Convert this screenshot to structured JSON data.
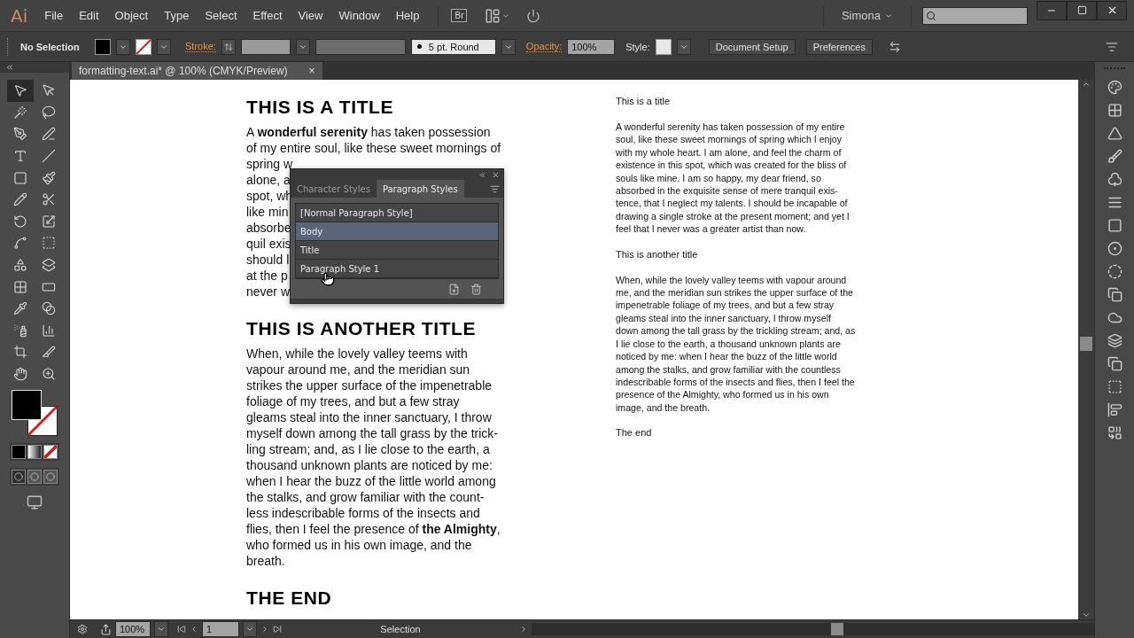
{
  "menu_bar": {
    "logo": "Ai",
    "menus": [
      "File",
      "Edit",
      "Object",
      "Type",
      "Select",
      "Effect",
      "View",
      "Window",
      "Help"
    ],
    "bridge_button": "Br",
    "user": "Simona"
  },
  "control_bar": {
    "selection": "No Selection",
    "stroke_label": "Stroke:",
    "brush": "5 pt. Round",
    "opacity_label": "Opacity:",
    "opacity": "100%",
    "style_label": "Style:",
    "buttons": [
      "Document Setup",
      "Preferences"
    ]
  },
  "document_tab": {
    "title": "formatting-text.ai* @ 100% (CMYK/Preview)",
    "close": "×"
  },
  "tools": [
    {
      "kind": "selection",
      "selected": true
    },
    {
      "kind": "direct-selection",
      "selected": false
    },
    {
      "kind": "magic-wand",
      "selected": false
    },
    {
      "kind": "lasso",
      "selected": false
    },
    {
      "kind": "pen",
      "selected": false
    },
    {
      "kind": "curvature",
      "selected": false
    },
    {
      "kind": "type",
      "selected": false
    },
    {
      "kind": "line",
      "selected": false
    },
    {
      "kind": "rectangle",
      "selected": false
    },
    {
      "kind": "paintbrush",
      "selected": false
    },
    {
      "kind": "pencil",
      "selected": false
    },
    {
      "kind": "scissors",
      "selected": false
    },
    {
      "kind": "rotate",
      "selected": false
    },
    {
      "kind": "scale",
      "selected": false
    },
    {
      "kind": "warp",
      "selected": false
    },
    {
      "kind": "free-transform",
      "selected": false
    },
    {
      "kind": "shape-builder",
      "selected": false
    },
    {
      "kind": "graph-stack",
      "selected": false
    },
    {
      "kind": "mesh",
      "selected": false
    },
    {
      "kind": "gradient",
      "selected": false
    },
    {
      "kind": "eyedropper",
      "selected": false
    },
    {
      "kind": "blend",
      "selected": false
    },
    {
      "kind": "symbol-sprayer",
      "selected": false
    },
    {
      "kind": "graph",
      "selected": false
    },
    {
      "kind": "artboard",
      "selected": false
    },
    {
      "kind": "slice",
      "selected": false
    },
    {
      "kind": "hand",
      "selected": false
    },
    {
      "kind": "zoom",
      "selected": false
    }
  ],
  "document": {
    "left": [
      {
        "kind": "heading",
        "text": "THIS IS A TITLE"
      },
      {
        "kind": "paragraph",
        "lines": [
          "A **wonderful serenity** has taken possession",
          "of my entire soul, like these sweet mornings of",
          "spring w",
          "alone, a",
          "spot, wh",
          "like min",
          "absorbe",
          "quil exis",
          "should l",
          "at the p",
          "never w"
        ]
      },
      {
        "kind": "heading",
        "text": "THIS IS ANOTHER TITLE"
      },
      {
        "kind": "paragraph",
        "lines": [
          "When, while the lovely valley teems with",
          "vapour around me, and the meridian sun",
          "strikes the upper surface of the impenetrable",
          "foliage of my trees, and but a few stray",
          "gleams steal into the inner sanctuary, I throw",
          "myself down among the tall grass by the trick-",
          "ling stream; and, as I lie close to the earth, a",
          "thousand unknown plants are noticed by me:",
          "when I hear the buzz of the little world among",
          "the stalks, and grow familiar with the count-",
          "less indescribable forms of the insects and",
          "flies, then I feel the presence of **the Almighty**,",
          "who formed us in his own image, and the",
          "breath."
        ]
      },
      {
        "kind": "heading",
        "text": "THE END"
      }
    ],
    "right": [
      {
        "kind": "heading",
        "text": "This is a title"
      },
      {
        "kind": "paragraph",
        "lines": [
          "A wonderful serenity has taken possession of my entire",
          "soul, like these sweet mornings of spring which I enjoy",
          "with my whole heart. I am alone, and feel the charm of",
          "existence in this spot, which was created for the bliss of",
          "souls like mine. I am so happy, my dear friend, so",
          "absorbed in the exquisite sense of mere tranquil exis-",
          "tence, that I neglect my talents. I should be incapable of",
          "drawing a single stroke at the present moment; and yet I",
          "feel that I never was a greater artist than now."
        ]
      },
      {
        "kind": "heading",
        "text": "This is another title"
      },
      {
        "kind": "paragraph",
        "lines": [
          "When, while the lovely valley teems with vapour around",
          "me, and the meridian sun strikes the upper surface of the",
          "impenetrable foliage of my trees, and but a few stray",
          "gleams steal into the inner sanctuary, I throw myself",
          "down among the tall grass by the trickling stream; and, as",
          "I lie close to the earth, a thousand unknown plants are",
          "noticed by me: when I hear the buzz of the little world",
          "among the stalks, and grow familiar with the countless",
          "indescribable forms of the insects and flies, then I feel the",
          "presence of the Almighty, who formed us in his own",
          "image, and the breath."
        ]
      },
      {
        "kind": "heading",
        "text": "The end"
      }
    ]
  },
  "styles_panel": {
    "tabs": [
      {
        "label": "Character Styles",
        "selected": false
      },
      {
        "label": "Paragraph Styles",
        "selected": true
      }
    ],
    "items": [
      {
        "label": "[Normal Paragraph Style]",
        "selected": false
      },
      {
        "label": "Body",
        "selected": true
      },
      {
        "label": "Title",
        "selected": false
      },
      {
        "label": "Paragraph Style 1",
        "selected": false
      }
    ]
  },
  "status_bar": {
    "zoom": "100%",
    "page": "1",
    "tool": "Selection"
  }
}
